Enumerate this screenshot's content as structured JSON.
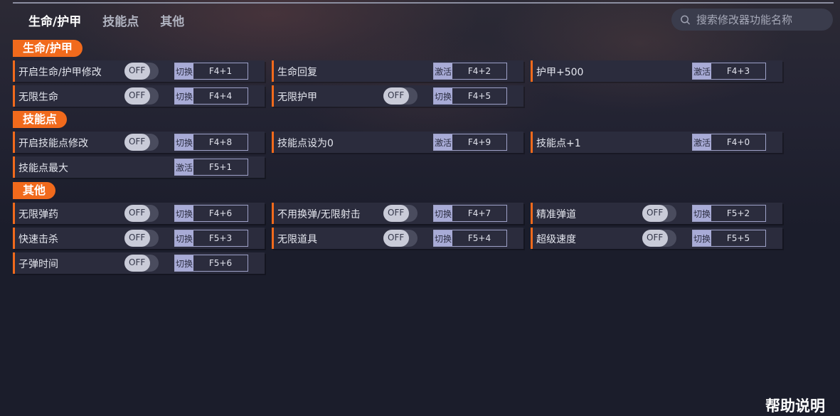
{
  "tabs": [
    {
      "label": "生命/护甲",
      "active": true
    },
    {
      "label": "技能点",
      "active": false
    },
    {
      "label": "其他",
      "active": false
    }
  ],
  "search": {
    "placeholder": "搜索修改器功能名称"
  },
  "sections": [
    {
      "title": "生命/护甲"
    },
    {
      "title": "技能点"
    },
    {
      "title": "其他"
    }
  ],
  "rows": [
    {
      "label": "开启生命/护甲修改",
      "has_toggle": true,
      "toggle": "OFF",
      "action": "切换",
      "hotkey": "F4+1"
    },
    {
      "label": "生命回复",
      "has_toggle": false,
      "action": "激活",
      "hotkey": "F4+2"
    },
    {
      "label": "护甲+500",
      "has_toggle": false,
      "action": "激活",
      "hotkey": "F4+3"
    },
    {
      "label": "无限生命",
      "has_toggle": true,
      "toggle": "OFF",
      "action": "切换",
      "hotkey": "F4+4"
    },
    {
      "label": "无限护甲",
      "has_toggle": true,
      "toggle": "OFF",
      "action": "切换",
      "hotkey": "F4+5"
    },
    {
      "label": "开启技能点修改",
      "has_toggle": true,
      "toggle": "OFF",
      "action": "切换",
      "hotkey": "F4+8"
    },
    {
      "label": "技能点设为0",
      "has_toggle": false,
      "action": "激活",
      "hotkey": "F4+9"
    },
    {
      "label": "技能点+1",
      "has_toggle": false,
      "action": "激活",
      "hotkey": "F4+0"
    },
    {
      "label": "技能点最大",
      "has_toggle": false,
      "action": "激活",
      "hotkey": "F5+1"
    },
    {
      "label": "无限弹药",
      "has_toggle": true,
      "toggle": "OFF",
      "action": "切换",
      "hotkey": "F4+6"
    },
    {
      "label": "不用换弹/无限射击",
      "has_toggle": true,
      "toggle": "OFF",
      "action": "切换",
      "hotkey": "F4+7"
    },
    {
      "label": "精准弹道",
      "has_toggle": true,
      "toggle": "OFF",
      "action": "切换",
      "hotkey": "F5+2"
    },
    {
      "label": "快速击杀",
      "has_toggle": true,
      "toggle": "OFF",
      "action": "切换",
      "hotkey": "F5+3"
    },
    {
      "label": "无限道具",
      "has_toggle": true,
      "toggle": "OFF",
      "action": "切换",
      "hotkey": "F5+4"
    },
    {
      "label": "超级速度",
      "has_toggle": true,
      "toggle": "OFF",
      "action": "切换",
      "hotkey": "F5+5"
    },
    {
      "label": "子弹时间",
      "has_toggle": true,
      "toggle": "OFF",
      "action": "切换",
      "hotkey": "F5+6"
    }
  ],
  "help_label": "帮助说明",
  "colors": {
    "accent": "#f16a1c",
    "background": "#1b1d2b",
    "row": "#2b2c3d"
  }
}
